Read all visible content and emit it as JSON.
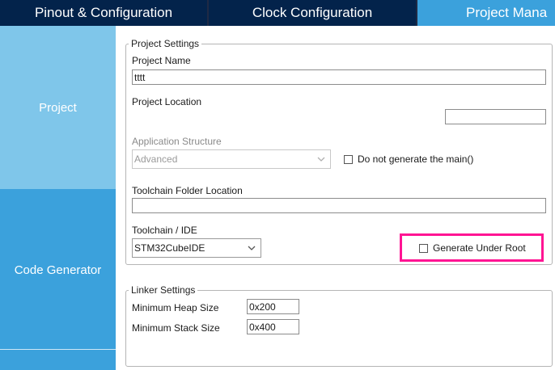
{
  "tabs": [
    {
      "label": "Pinout & Configuration"
    },
    {
      "label": "Clock Configuration"
    },
    {
      "label": "Project Mana"
    }
  ],
  "left_panel": {
    "items": [
      {
        "label": "Project"
      },
      {
        "label": "Code Generator"
      }
    ]
  },
  "project_settings": {
    "legend": "Project Settings",
    "project_name_label": "Project Name",
    "project_name_value": "tttt",
    "project_location_label": "Project Location",
    "project_location_value": "",
    "application_structure_label": "Application Structure",
    "application_structure_value": "Advanced",
    "do_not_generate_main_label": "Do not generate the main()",
    "toolchain_folder_label": "Toolchain Folder Location",
    "toolchain_folder_value": "",
    "toolchain_ide_label": "Toolchain / IDE",
    "toolchain_ide_value": "STM32CubeIDE",
    "generate_under_root_label": "Generate Under Root"
  },
  "linker_settings": {
    "legend": "Linker Settings",
    "min_heap_label": "Minimum Heap Size",
    "min_heap_value": "0x200",
    "min_stack_label": "Minimum Stack Size",
    "min_stack_value": "0x400"
  },
  "colors": {
    "tab_dark": "#03234b",
    "tab_active": "#3ba1dc",
    "panel_selected": "#7fc6ea",
    "highlight": "#ff1493"
  }
}
